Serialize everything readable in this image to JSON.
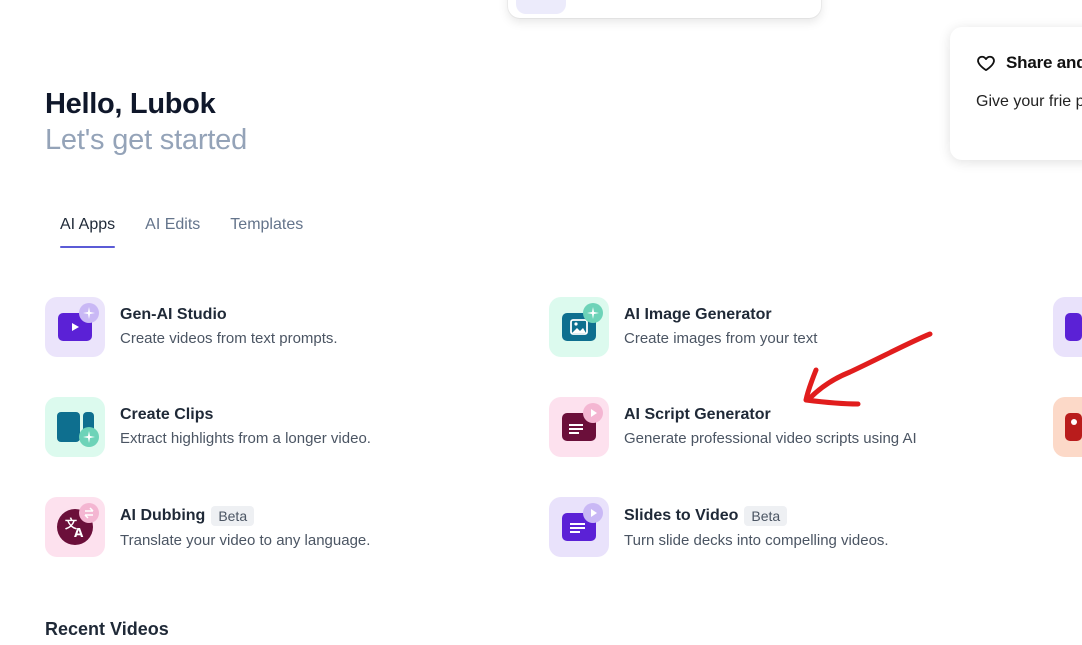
{
  "greeting": {
    "hello": "Hello, Lubok",
    "subtitle": "Let's get started"
  },
  "share": {
    "title": "Share and",
    "text": "Give your frie purchase they"
  },
  "tabs": [
    {
      "label": "AI Apps",
      "active": true
    },
    {
      "label": "AI Edits",
      "active": false
    },
    {
      "label": "Templates",
      "active": false
    }
  ],
  "apps": [
    {
      "title": "Gen-AI Studio",
      "desc": "Create videos from text prompts.",
      "badge": "",
      "icon": "video-play-icon",
      "accent": "#5b21d6"
    },
    {
      "title": "AI Image Generator",
      "desc": "Create images from your text",
      "badge": "",
      "icon": "image-icon",
      "accent": "#0e6f8f"
    },
    {
      "title": "Create Clips",
      "desc": "Extract highlights from a longer video.",
      "badge": "",
      "icon": "clips-icon",
      "accent": "#0e6f8f"
    },
    {
      "title": "AI Script Generator",
      "desc": "Generate professional video scripts using AI",
      "badge": "",
      "icon": "script-icon",
      "accent": "#7a0f3f"
    },
    {
      "title": "AI Dubbing",
      "desc": "Translate your video to any language.",
      "badge": "Beta",
      "icon": "translate-icon",
      "accent": "#6b0f3a"
    },
    {
      "title": "Slides to Video",
      "desc": "Turn slide decks into compelling videos.",
      "badge": "Beta",
      "icon": "slides-icon",
      "accent": "#5b21d6"
    }
  ],
  "recent": {
    "title": "Recent Videos"
  },
  "colors": {
    "tab_indicator": "#5b5bd6",
    "annotation": "#e11d1d"
  }
}
